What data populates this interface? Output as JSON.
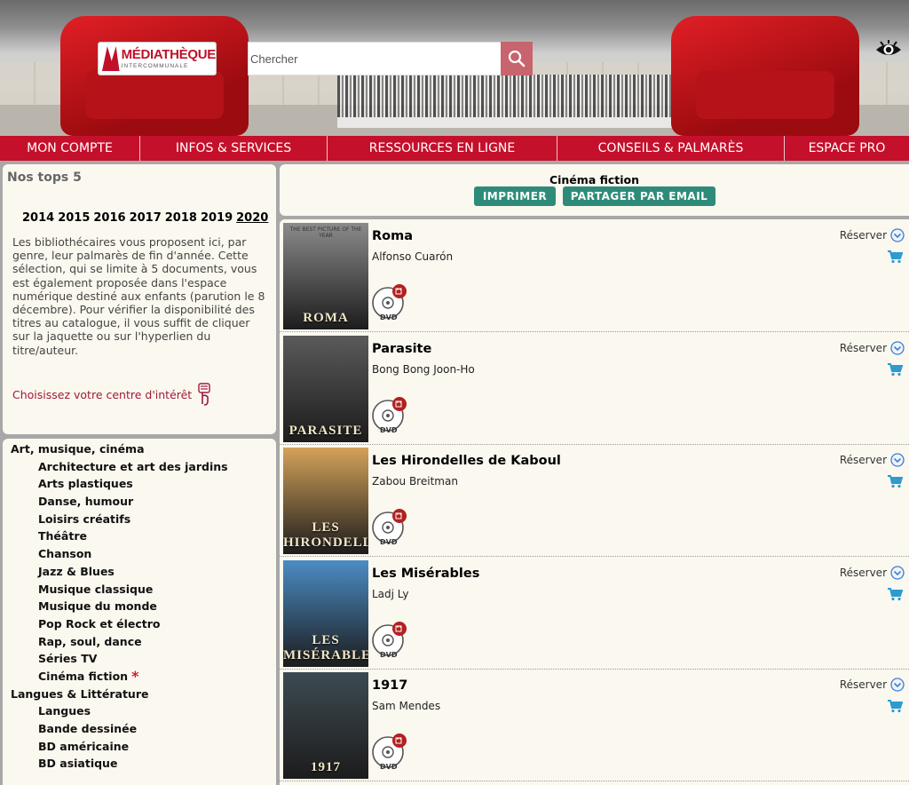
{
  "header": {
    "logo": {
      "big": "MÉDIATHÈQUE",
      "small": "INTERCOMMUNALE"
    },
    "search_placeholder": "Chercher"
  },
  "nav": [
    {
      "label": "MON COMPTE"
    },
    {
      "label": "INFOS & SERVICES"
    },
    {
      "label": "RESSOURCES EN LIGNE"
    },
    {
      "label": "CONSEILS & PALMARÈS"
    },
    {
      "label": "ESPACE PRO"
    }
  ],
  "tops": {
    "title": "Nos tops 5",
    "years": [
      "2014",
      "2015",
      "2016",
      "2017",
      "2018",
      "2019",
      "2020"
    ],
    "current_year": "2020",
    "intro": "Les bibliothécaires vous proposent ici, par genre, leur palmarès de fin d'année. Cette sélection, qui se limite à 5 documents, vous est également proposée dans l'espace numérique destiné aux enfants (parution le 8 décembre). Pour vérifier la disponibilité des titres au catalogue, il vous suffit de cliquer sur la jaquette ou sur l'hyperlien du titre/auteur.",
    "interest_link": "Choisissez votre centre d'intérêt"
  },
  "categories": [
    {
      "group": "Art, musique, cinéma",
      "items": [
        "Architecture et art des jardins",
        "Arts plastiques",
        "Danse, humour",
        "Loisirs créatifs",
        "Théâtre",
        "Chanson",
        "Jazz & Blues",
        "Musique classique",
        "Musique du monde",
        "Pop Rock et électro",
        "Rap, soul, dance",
        "Séries TV",
        "Cinéma fiction"
      ],
      "active": "Cinéma fiction"
    },
    {
      "group": "Langues & Littérature",
      "items": [
        "Langues",
        "Bande dessinée",
        "BD américaine",
        "BD asiatique"
      ]
    }
  ],
  "active_star": "*",
  "results_header": {
    "category": "Cinéma fiction",
    "print_label": "IMPRIMER",
    "share_label": "PARTAGER PAR EMAIL"
  },
  "results": [
    {
      "title": "Roma",
      "author": "Alfonso Cuarón",
      "cover_text": "ROMA",
      "cover_caption": "THE BEST PICTURE OF THE YEAR",
      "cover_bg": "#8b8b8b",
      "format": "DVD",
      "reserve": "Réserver"
    },
    {
      "title": "Parasite",
      "author": "Bong Bong Joon-Ho",
      "cover_text": "PARASITE",
      "cover_caption": "",
      "cover_bg": "#5a5a5a",
      "format": "DVD",
      "reserve": "Réserver"
    },
    {
      "title": "Les Hirondelles de Kaboul",
      "author": "Zabou Breitman",
      "cover_text": "LES HIRONDELLES",
      "cover_caption": "",
      "cover_bg": "#d4a25a",
      "format": "DVD",
      "reserve": "Réserver"
    },
    {
      "title": "Les Misérables",
      "author": "Ladj Ly",
      "cover_text": "LES MISÉRABLES",
      "cover_caption": "",
      "cover_bg": "#4b8cc4",
      "format": "DVD",
      "reserve": "Réserver"
    },
    {
      "title": "1917",
      "author": "Sam Mendes",
      "cover_text": "1917",
      "cover_caption": "",
      "cover_bg": "#3d4a52",
      "format": "DVD",
      "reserve": "Réserver"
    }
  ],
  "colors": {
    "brand_red": "#c5102b",
    "accent_teal": "#2e8b7a",
    "panel_bg": "#fbf8ef",
    "link_red": "#a0183a"
  },
  "icons": {
    "search": "search-icon",
    "accessibility": "eye-icon",
    "reserve": "chevron-down-circle-icon",
    "cart": "cart-icon",
    "dvd": "dvd-icon",
    "pointer": "pointing-hand-icon"
  }
}
